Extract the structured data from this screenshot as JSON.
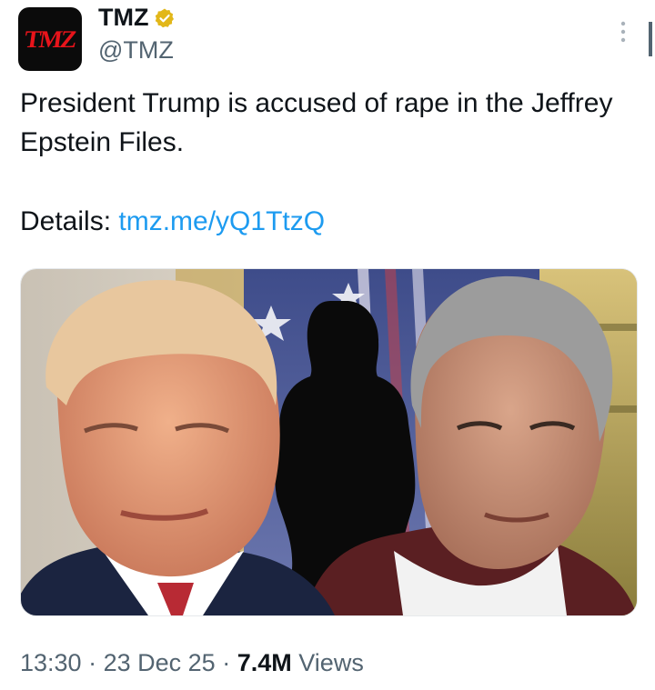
{
  "author": {
    "display_name": "TMZ",
    "handle": "@TMZ",
    "avatar_text": "TMZ",
    "verified_icon": "gold-verified-badge",
    "verified_color": "#e2b719"
  },
  "tweet": {
    "text": "President Trump is accused of rape in the Jeffrey Epstein Files.",
    "details_label": "Details:",
    "link": "tmz.me/yQ1TtzQ"
  },
  "media": {
    "description_icon": "photo-collage"
  },
  "meta": {
    "time": "13:30",
    "date": "23 Dec 25",
    "views_count": "7.4M",
    "views_label": "Views",
    "separator": "·"
  },
  "colors": {
    "link": "#1d9bf0",
    "secondary_text": "#536471",
    "primary_text": "#0f1419"
  }
}
